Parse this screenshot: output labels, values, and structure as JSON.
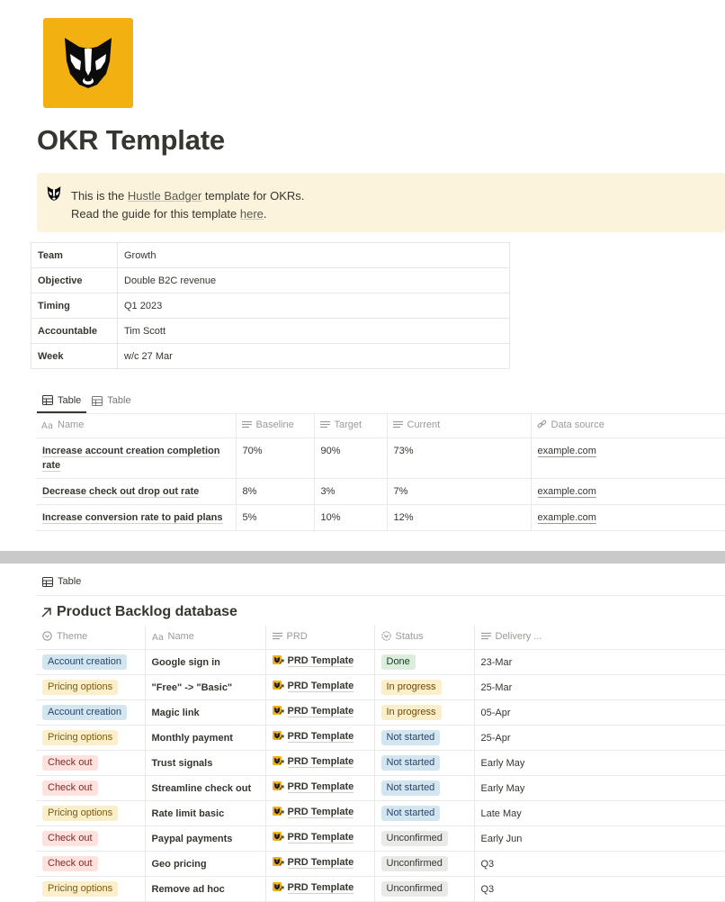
{
  "page": {
    "title": "OKR Template",
    "icon": "badger-icon"
  },
  "callout": {
    "icon": "badger-icon",
    "line1_prefix": "This is the ",
    "line1_link": "Hustle Badger",
    "line1_suffix": " template for OKRs.",
    "line2_prefix": "Read the guide for this template ",
    "line2_link": "here",
    "line2_suffix": "."
  },
  "properties": [
    {
      "key": "Team",
      "value": "Growth"
    },
    {
      "key": "Objective",
      "value": "Double B2C revenue"
    },
    {
      "key": "Timing",
      "value": "Q1 2023"
    },
    {
      "key": "Accountable",
      "value": "Tim Scott"
    },
    {
      "key": "Week",
      "value": "w/c 27 Mar"
    }
  ],
  "view_tabs": [
    {
      "label": "Table",
      "icon": "table-icon",
      "active": true
    },
    {
      "label": "Table",
      "icon": "table-icon",
      "active": false
    }
  ],
  "okr_table": {
    "columns": [
      {
        "label": "Name",
        "icon": "text-aa-icon"
      },
      {
        "label": "Baseline",
        "icon": "text-lines-icon"
      },
      {
        "label": "Target",
        "icon": "text-lines-icon"
      },
      {
        "label": "Current",
        "icon": "text-lines-icon"
      },
      {
        "label": "Data source",
        "icon": "link-icon"
      }
    ],
    "rows": [
      {
        "name": "Increase account creation completion rate",
        "baseline": "70%",
        "target": "90%",
        "current": "73%",
        "source": "example.com"
      },
      {
        "name": "Decrease check out drop out rate",
        "baseline": "8%",
        "target": "3%",
        "current": "7%",
        "source": "example.com"
      },
      {
        "name": "Increase conversion rate to paid plans",
        "baseline": "5%",
        "target": "10%",
        "current": "12%",
        "source": "example.com"
      }
    ]
  },
  "backlog_view_tab": {
    "label": "Table",
    "icon": "table-icon"
  },
  "backlog": {
    "title": "Product Backlog database",
    "title_icon": "arrow-up-right-icon",
    "columns": [
      {
        "label": "Theme",
        "icon": "select-icon"
      },
      {
        "label": "Name",
        "icon": "text-aa-icon"
      },
      {
        "label": "PRD",
        "icon": "text-lines-icon"
      },
      {
        "label": "Status",
        "icon": "status-icon"
      },
      {
        "label": "Delivery ...",
        "icon": "text-lines-icon"
      }
    ],
    "colors": {
      "Account creation": {
        "bg": "#d3e5ef",
        "fg": "#28456c"
      },
      "Pricing options": {
        "bg": "#fbeeca",
        "fg": "#7a5b10"
      },
      "Check out": {
        "bg": "#ffe2dd",
        "fg": "#7d2a2a"
      },
      "Done": {
        "bg": "#dbeddb",
        "fg": "#1c3829"
      },
      "In progress": {
        "bg": "#fbeeca",
        "fg": "#6b4a09"
      },
      "Not started": {
        "bg": "#d3e5ef",
        "fg": "#28456c"
      },
      "Unconfirmed": {
        "bg": "#e9e9e7",
        "fg": "#37352f"
      }
    },
    "rows": [
      {
        "theme": "Account creation",
        "name": "Google sign in",
        "prd": "PRD Template",
        "status": "Done",
        "delivery": "23-Mar"
      },
      {
        "theme": "Pricing options",
        "name": "\"Free\" -> \"Basic\"",
        "prd": "PRD Template",
        "status": "In progress",
        "delivery": "25-Mar"
      },
      {
        "theme": "Account creation",
        "name": "Magic link",
        "prd": "PRD Template",
        "status": "In progress",
        "delivery": "05-Apr"
      },
      {
        "theme": "Pricing options",
        "name": "Monthly payment",
        "prd": "PRD Template",
        "status": "Not started",
        "delivery": "25-Apr"
      },
      {
        "theme": "Check out",
        "name": "Trust signals",
        "prd": "PRD Template",
        "status": "Not started",
        "delivery": "Early May"
      },
      {
        "theme": "Check out",
        "name": "Streamline check out",
        "prd": "PRD Template",
        "status": "Not started",
        "delivery": "Early May"
      },
      {
        "theme": "Pricing options",
        "name": "Rate limit basic",
        "prd": "PRD Template",
        "status": "Not started",
        "delivery": "Late May"
      },
      {
        "theme": "Check out",
        "name": "Paypal payments",
        "prd": "PRD Template",
        "status": "Unconfirmed",
        "delivery": "Early Jun"
      },
      {
        "theme": "Check out",
        "name": "Geo pricing",
        "prd": "PRD Template",
        "status": "Unconfirmed",
        "delivery": "Q3"
      },
      {
        "theme": "Pricing options",
        "name": "Remove ad hoc",
        "prd": "PRD Template",
        "status": "Unconfirmed",
        "delivery": "Q3"
      }
    ]
  }
}
